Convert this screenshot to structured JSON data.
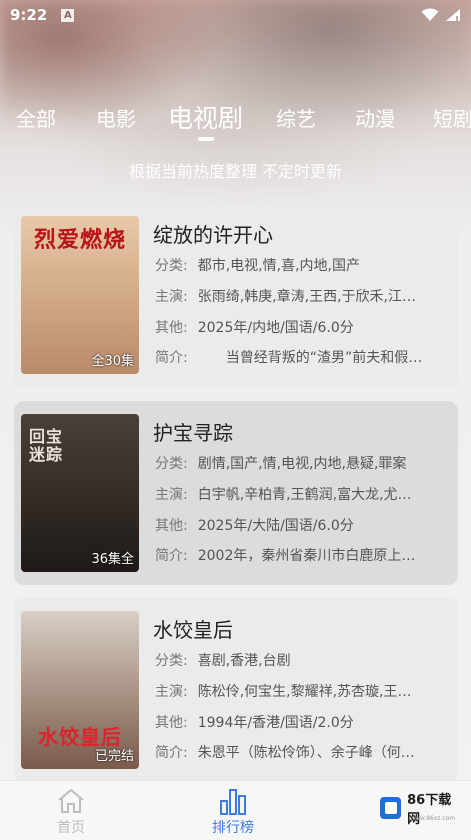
{
  "status_bar": {
    "time": "9:22",
    "badge": "A"
  },
  "tabs": [
    {
      "label": "全部",
      "active": false
    },
    {
      "label": "电影",
      "active": false
    },
    {
      "label": "电视剧",
      "active": true
    },
    {
      "label": "综艺",
      "active": false
    },
    {
      "label": "动漫",
      "active": false
    },
    {
      "label": "短剧",
      "active": false
    }
  ],
  "subtitle": "根据当前热度整理 不定时更新",
  "items": [
    {
      "title": "绽放的许开心",
      "poster_title": "烈爱燃烧",
      "badge": "全30集",
      "genre_label": "分类:",
      "genre": "都市,电视,情,喜,内地,国产",
      "cast_label": "主演:",
      "cast": "张雨绮,韩庚,章涛,王西,于欣禾,江…",
      "other_label": "其他:",
      "other": "2025年/内地/国语/6.0分",
      "intro_label": "简介:",
      "intro": "　　当曾经背叛的“渣男”前夫和假…",
      "poster_colors": [
        "#e9c9a8",
        "#b98a6a"
      ],
      "poster_text_color": "#b8141b"
    },
    {
      "title": "护宝寻踪",
      "poster_title": "回宝迷踪",
      "badge": "36集全",
      "genre_label": "分类:",
      "genre": "剧情,国产,情,电视,内地,悬疑,罪案",
      "cast_label": "主演:",
      "cast": "白宇帆,辛柏青,王鹤润,富大龙,尤…",
      "other_label": "其他:",
      "other": "2025年/大陆/国语/6.0分",
      "intro_label": "简介:",
      "intro": "2002年，秦州省秦川市白鹿原上…",
      "poster_colors": [
        "#4a4038",
        "#1f1a17"
      ],
      "poster_text_color": "#e8e2d8"
    },
    {
      "title": "水饺皇后",
      "poster_title": "水饺皇后",
      "badge": "已完结",
      "genre_label": "分类:",
      "genre": "喜剧,香港,台剧",
      "cast_label": "主演:",
      "cast": "陈松伶,何宝生,黎耀祥,苏杏璇,王…",
      "other_label": "其他:",
      "other": "1994年/香港/国语/2.0分",
      "intro_label": "简介:",
      "intro": "朱恩平（陈松伶饰）、余子峰（何…",
      "poster_colors": [
        "#d9cfc4",
        "#7a5a4a"
      ],
      "poster_text_color": "#e0202a"
    }
  ],
  "bottom_nav": [
    {
      "label": "首页",
      "icon": "home-icon",
      "active": false
    },
    {
      "label": "排行榜",
      "icon": "ranking-icon",
      "active": true
    }
  ],
  "watermark": {
    "text": "86下载网",
    "sub": "www.86xz.com"
  },
  "colors": {
    "accent": "#3d7be0",
    "nav_inactive": "#bdbdbd",
    "card_bg": "#ebebeb"
  }
}
